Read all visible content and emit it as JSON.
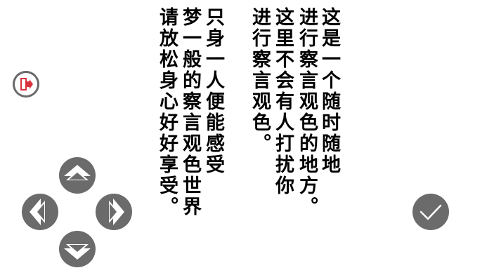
{
  "narration": {
    "columns": [
      "这是一个随时随地",
      "进行察言观色的地方。",
      "这里不会有人打扰你",
      "进行察言观色。",
      "只身一人便能感受",
      "梦一般的察言观色世界",
      "请放松身心好好享受。"
    ]
  },
  "controls": {
    "exit_icon": "exit-door-icon",
    "dpad_icons": [
      "arrow-up-icon",
      "arrow-left-icon",
      "arrow-right-icon",
      "arrow-down-icon"
    ],
    "confirm_icon": "checkmark-icon"
  },
  "colors": {
    "button_fill": "#6b6b6b",
    "arrow_fill": "#ffffff",
    "exit_accent": "#d9323c",
    "text": "#000000"
  }
}
